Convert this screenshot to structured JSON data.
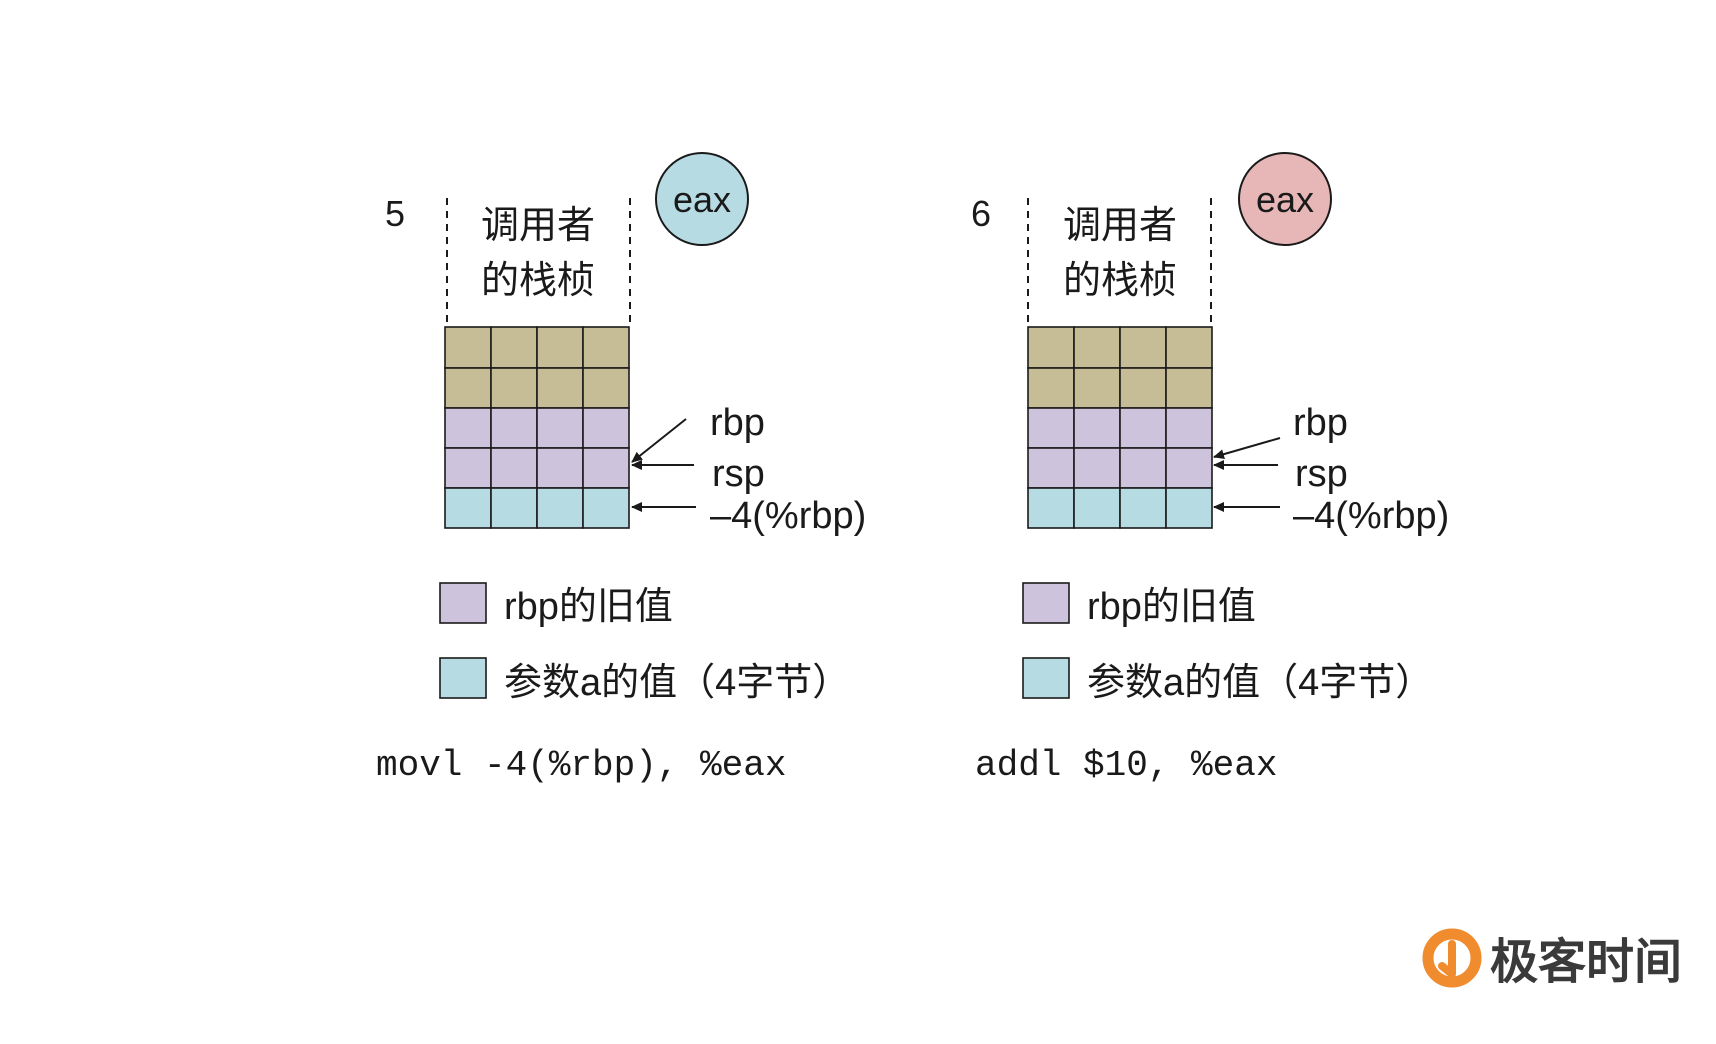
{
  "colors": {
    "caller_frame": "#c6bd97",
    "old_rbp": "#cdc3dd",
    "param_a": "#b6dbe3",
    "eax_panel5": "#b6dbe3",
    "eax_panel6": "#e7b6b6",
    "logo_orange": "#f08c2e"
  },
  "panels": [
    {
      "step": "5",
      "eax_label": "eax",
      "frame_label_line1": "调用者",
      "frame_label_line2": "的栈桢",
      "pointer_rbp": "rbp",
      "pointer_rsp": "rsp",
      "pointer_param": "–4(%rbp)",
      "legend_old_rbp": "rbp的旧值",
      "legend_param": "参数a的值（4字节）",
      "instruction": "movl -4(%rbp), %eax"
    },
    {
      "step": "6",
      "eax_label": "eax",
      "frame_label_line1": "调用者",
      "frame_label_line2": "的栈桢",
      "pointer_rbp": "rbp",
      "pointer_rsp": "rsp",
      "pointer_param": "–4(%rbp)",
      "legend_old_rbp": "rbp的旧值",
      "legend_param": "参数a的值（4字节）",
      "instruction": "addl $10, %eax"
    }
  ],
  "logo": {
    "text": "极客时间",
    "icon": "geektime-logo-icon"
  }
}
